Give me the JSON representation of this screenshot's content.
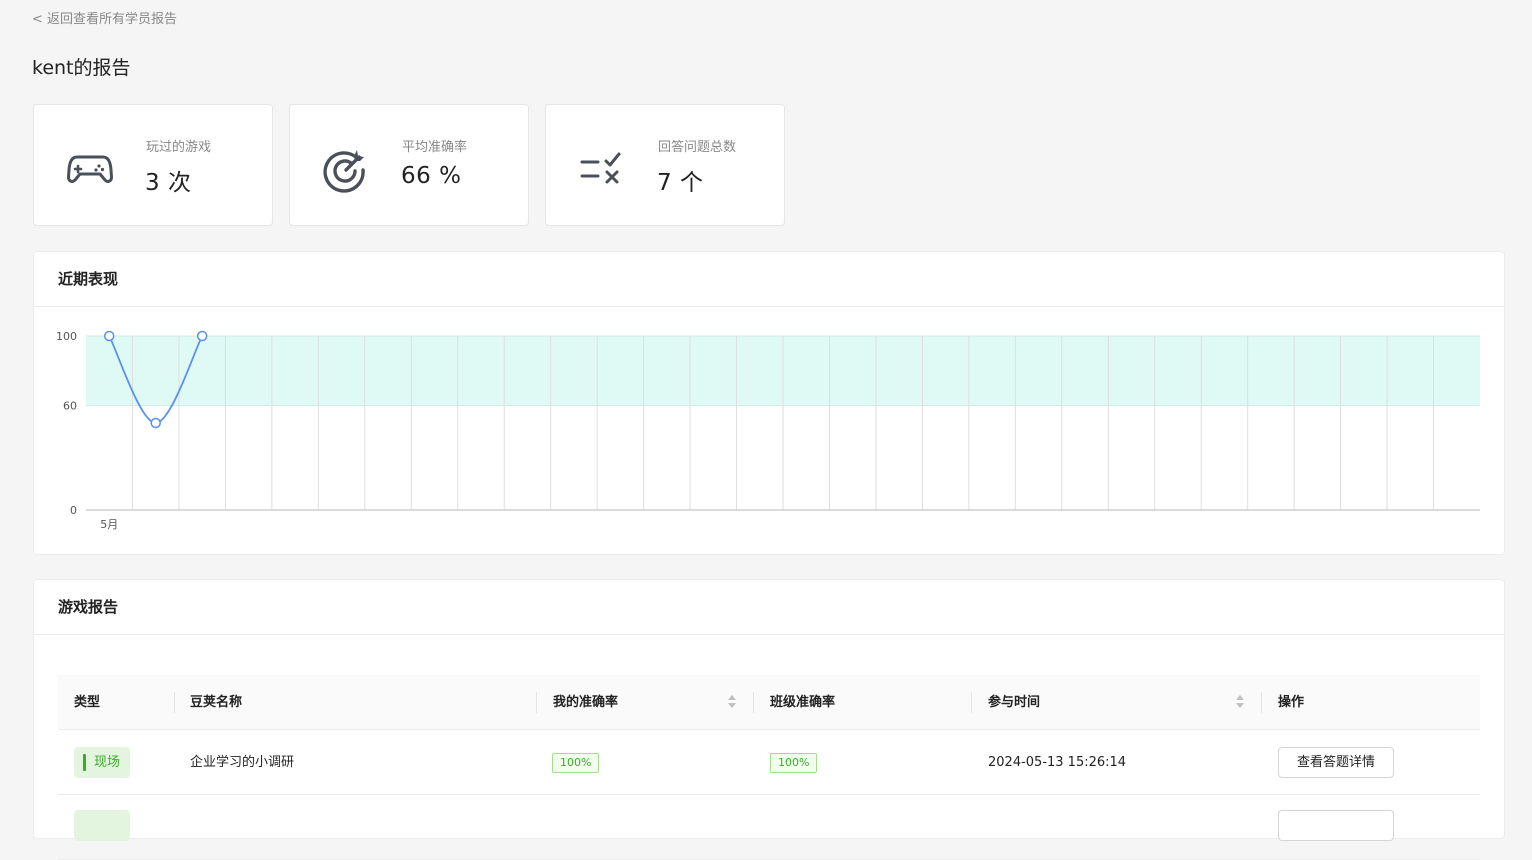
{
  "nav": {
    "back_label": "< 返回查看所有学员报告"
  },
  "page": {
    "title": "kent的报告"
  },
  "stats": [
    {
      "label": "玩过的游戏",
      "value": "3 次",
      "icon": "gamepad-icon"
    },
    {
      "label": "平均准确率",
      "value": "66 %",
      "icon": "target-icon"
    },
    {
      "label": "回答问题总数",
      "value": "7 个",
      "icon": "check-cross-list-icon"
    }
  ],
  "recent": {
    "title": "近期表现"
  },
  "chart_data": {
    "type": "line",
    "title": "",
    "x": [
      1,
      2,
      3
    ],
    "x_tick_labels": [
      "5月"
    ],
    "y_tick_labels": [
      "100",
      "60",
      "0"
    ],
    "series": [
      {
        "values": [
          100,
          50,
          100
        ]
      }
    ],
    "ylim": [
      0,
      100
    ],
    "band": [
      60,
      100
    ],
    "grid": true,
    "colors": {
      "line": "#5b8ff0",
      "band": "#dffaf5"
    }
  },
  "report": {
    "title": "游戏报告",
    "columns": [
      "类型",
      "豆荚名称",
      "我的准确率",
      "班级准确率",
      "参与时间",
      "操作"
    ],
    "rows": [
      {
        "type": "现场",
        "name": "企业学习的小调研",
        "my_accuracy": "100%",
        "class_accuracy": "100%",
        "time": "2024-05-13 15:26:14",
        "action": "查看答题详情"
      }
    ]
  }
}
